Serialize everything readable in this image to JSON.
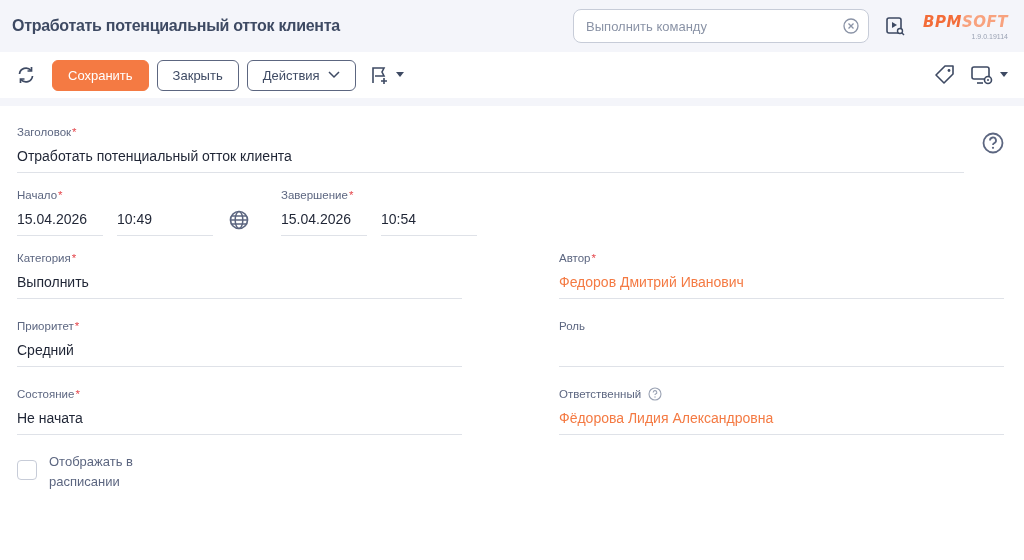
{
  "header": {
    "title": "Отработать потенциальный отток клиента",
    "command_search": {
      "placeholder": "Выполнить команду"
    },
    "logo": {
      "strong": "BPM",
      "light": "SOFT"
    },
    "version": "1.9.0.19114"
  },
  "toolbar": {
    "buttons": [
      {
        "label": "Сохранить",
        "kind": "primary"
      },
      {
        "label": "Закрыть",
        "kind": "outline"
      },
      {
        "label": "Действия",
        "kind": "menu"
      }
    ]
  },
  "form": {
    "title_field": {
      "label": "Заголовок",
      "mark": "*",
      "value": "Отработать потенциальный отток клиента"
    },
    "start": {
      "label": "Начало",
      "mark": "*",
      "date": "15.04.2026",
      "time": "10:49"
    },
    "end": {
      "label": "Завершение",
      "mark": "*",
      "date": "15.04.2026",
      "time": "10:54"
    },
    "left_fields": [
      {
        "label": "Категория",
        "mark": "*",
        "value": "Выполнить",
        "kind": "text"
      },
      {
        "label": "Приоритет",
        "mark": "*",
        "value": "Средний",
        "kind": "text"
      },
      {
        "label": "Состояние",
        "mark": "*",
        "value": "Не начата",
        "kind": "text"
      }
    ],
    "right_fields": [
      {
        "label": "Автор",
        "mark": "*",
        "value": "Федоров Дмитрий Иванович",
        "kind": "link"
      },
      {
        "label": "Роль",
        "kind": "text"
      },
      {
        "label": "Ответственный",
        "value": "Фёдорова Лидия Александровна",
        "kind": "link",
        "help": true
      }
    ],
    "schedule_checkbox": {
      "label": "Отображать в расписании",
      "checked": false
    }
  }
}
